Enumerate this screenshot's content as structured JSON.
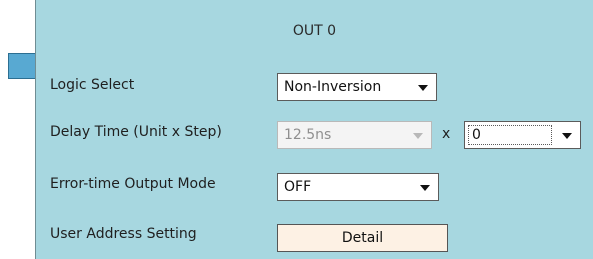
{
  "panel": {
    "title": "OUT 0"
  },
  "rows": {
    "logic_select": {
      "label": "Logic Select",
      "value": "Non-Inversion"
    },
    "delay_time": {
      "label": "Delay Time (Unit x Step)",
      "unit_value": "12.5ns",
      "multiplier": "x",
      "step_value": "0"
    },
    "error_output": {
      "label": "Error-time Output Mode",
      "value": "OFF"
    },
    "user_address": {
      "label": "User Address Setting",
      "button_label": "Detail"
    }
  },
  "icons": [
    "chevron-down-icon"
  ],
  "colors": {
    "panel_background": "#a7d7e0",
    "connector": "#58a9d2",
    "detail_button_background": "#fdf1e4"
  }
}
